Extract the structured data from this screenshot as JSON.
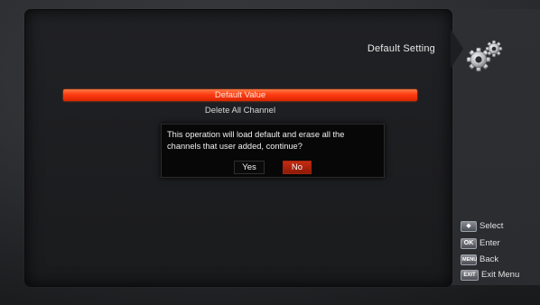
{
  "header": {
    "title": "Default Setting",
    "icon": "gear-icon"
  },
  "menu": {
    "items": [
      {
        "label": "Default Value",
        "selected": true
      },
      {
        "label": "Delete All Channel",
        "selected": false
      }
    ]
  },
  "dialog": {
    "message": "This operation will load default and erase all the channels that user added, continue?",
    "yes_label": "Yes",
    "no_label": "No",
    "focused": "No"
  },
  "hints": [
    {
      "key": "◆",
      "label": "Select",
      "icon": "select-key-icon"
    },
    {
      "key": "OK",
      "label": "Enter",
      "icon": "ok-key-icon"
    },
    {
      "key": "MENU",
      "label": "Back",
      "icon": "menu-key-icon"
    },
    {
      "key": "EXIT",
      "label": "Exit Menu",
      "icon": "exit-key-icon"
    }
  ],
  "colors": {
    "accent": "#ff3b12",
    "background": "#2f3134",
    "panel": "#1c1d1f"
  }
}
